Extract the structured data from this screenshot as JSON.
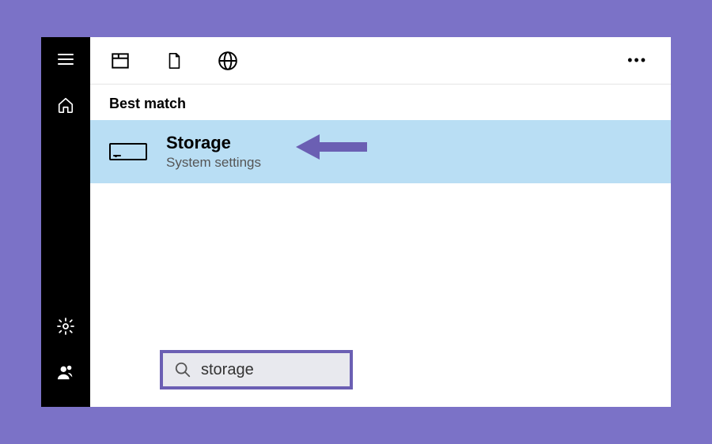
{
  "section": {
    "header": "Best match"
  },
  "result": {
    "title": "Storage",
    "subtitle": "System settings"
  },
  "search": {
    "value": "storage"
  },
  "colors": {
    "accent": "#7b72c7",
    "highlight": "#b9def4",
    "search_border": "#6b5fb3"
  }
}
